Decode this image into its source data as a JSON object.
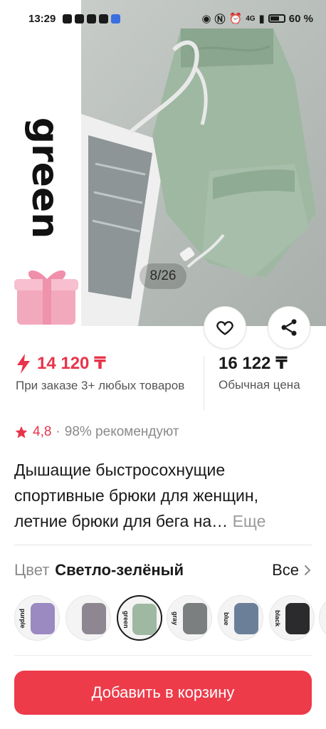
{
  "status_bar": {
    "time": "13:29",
    "signal_text": "4G",
    "battery": "60 %"
  },
  "hero": {
    "wordmark": "green",
    "counter": "8/26",
    "colors": {
      "pants": "#9fb8a2",
      "pants_shadow": "#8aa68e",
      "gift": "#f3a9bd"
    }
  },
  "price": {
    "promo_value": "14 120 ₸",
    "promo_note": "При заказе 3+ любых товаров",
    "regular_value": "16 122 ₸",
    "regular_note": "Обычная цена",
    "accent_color": "#e8334a"
  },
  "rating": {
    "value": "4,8",
    "separator": "·",
    "recommend": "98% рекомендуют"
  },
  "product": {
    "title": "Дышащие быстросохнущие спортивные брюки для женщин, летние брюки для бега на…",
    "more_label": "Еще"
  },
  "color": {
    "label": "Цвет",
    "selected": "Светло-зелёный",
    "all_label": "Все",
    "swatches": [
      {
        "tag": "purple",
        "color": "#9b89c2"
      },
      {
        "tag": "",
        "color": "#8e8690"
      },
      {
        "tag": "green",
        "color": "#9fb8a2",
        "selected": true
      },
      {
        "tag": "gray",
        "color": "#7c7f7f"
      },
      {
        "tag": "blue",
        "color": "#6c7f99"
      },
      {
        "tag": "black",
        "color": "#2b2b2e"
      },
      {
        "tag": "",
        "color": "#d0d0d0"
      }
    ]
  },
  "cta": {
    "add_to_cart": "Добавить в корзину",
    "color": "#ed3b4a"
  }
}
